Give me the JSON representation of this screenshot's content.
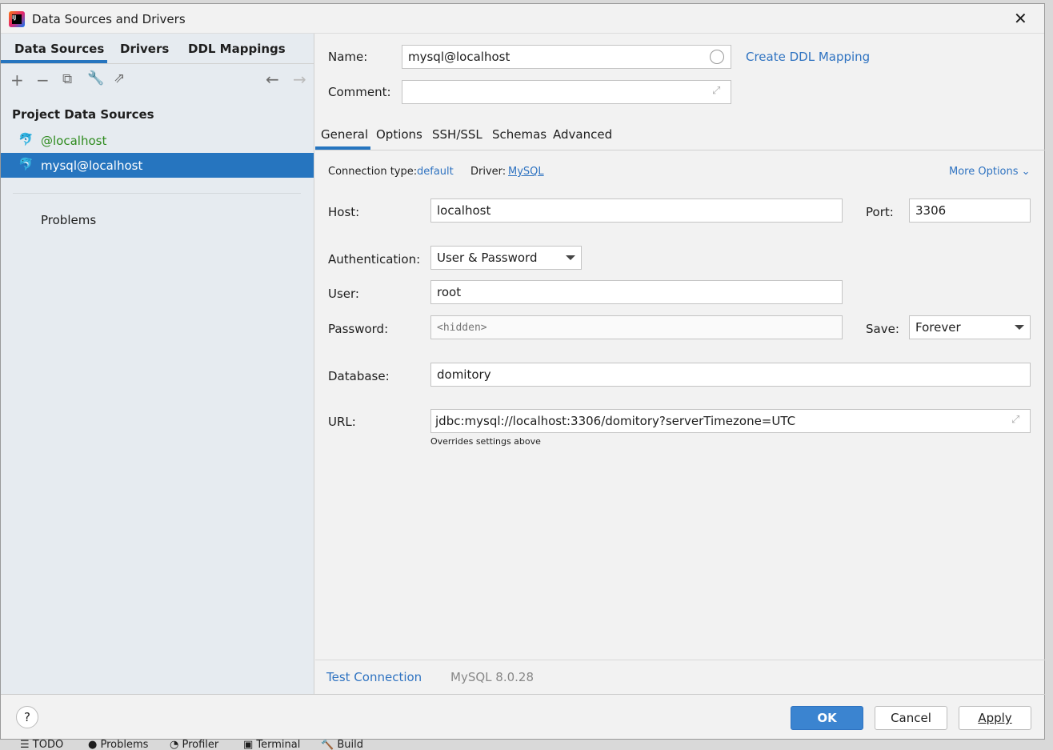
{
  "window": {
    "title": "Data Sources and Drivers"
  },
  "left": {
    "tabs": [
      "Data Sources",
      "Drivers",
      "DDL Mappings"
    ],
    "section": "Project Data Sources",
    "items": [
      {
        "label": "@localhost"
      },
      {
        "label": "mysql@localhost",
        "selected": true
      }
    ],
    "problems": "Problems"
  },
  "form": {
    "name_label": "Name:",
    "name_value": "mysql@localhost",
    "comment_label": "Comment:",
    "comment_value": "",
    "create_ddl": "Create DDL Mapping",
    "tabs": [
      "General",
      "Options",
      "SSH/SSL",
      "Schemas",
      "Advanced"
    ],
    "conn_type_label": "Connection type:",
    "conn_type_value": "default",
    "driver_label": "Driver:",
    "driver_value": "MySQL",
    "more_options": "More Options",
    "host_label": "Host:",
    "host_value": "localhost",
    "port_label": "Port:",
    "port_value": "3306",
    "auth_label": "Authentication:",
    "auth_value": "User & Password",
    "user_label": "User:",
    "user_value": "root",
    "password_label": "Password:",
    "password_placeholder": "<hidden>",
    "save_label": "Save:",
    "save_value": "Forever",
    "database_label": "Database:",
    "database_value": "domitory",
    "url_label": "URL:",
    "url_value": "jdbc:mysql://localhost:3306/domitory?serverTimezone=UTC",
    "url_hint": "Overrides settings above"
  },
  "status": {
    "test_connection": "Test Connection",
    "server_version": "MySQL 8.0.28"
  },
  "footer": {
    "help": "?",
    "ok": "OK",
    "cancel": "Cancel",
    "apply": "Apply"
  },
  "taskbar": [
    "TODO",
    "Problems",
    "Profiler",
    "Terminal",
    "Build"
  ],
  "colors": {
    "accent": "#2675bf",
    "selected_bg": "#2675bf",
    "green": "#2e8b1e"
  }
}
